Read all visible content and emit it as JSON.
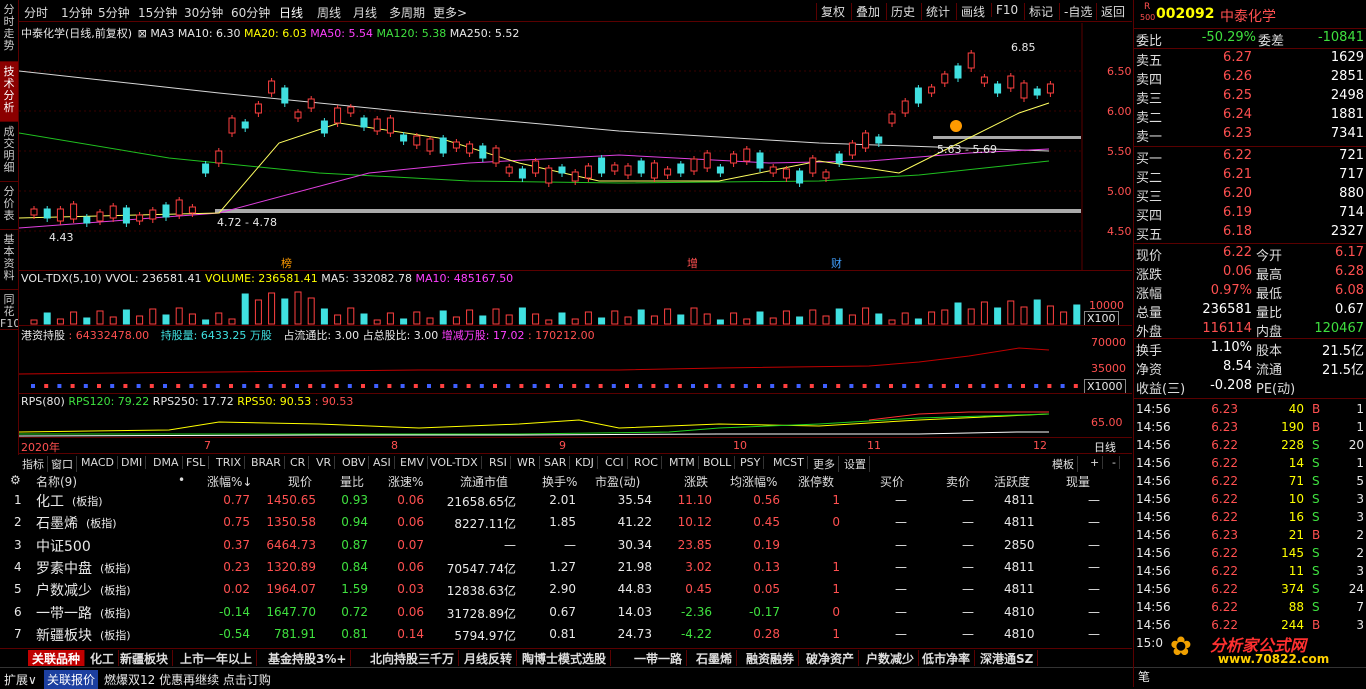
{
  "left_tabs": [
    "分时走势",
    "技术分析",
    "成交明细",
    "分价表",
    "基本资料",
    "同花F10"
  ],
  "periods": [
    "分时",
    "1分钟",
    "5分钟",
    "15分钟",
    "30分钟",
    "60分钟",
    "日线",
    "周线",
    "月线",
    "多周期",
    "更多>"
  ],
  "right_tools": [
    "复权",
    "叠加",
    "历史",
    "统计",
    "画线",
    "F10",
    "标记",
    "-自选",
    "返回"
  ],
  "main_legend": {
    "name": "中泰化学(日线,前复权)",
    "ma3": "MA3",
    "ma10": "MA10: 6.30",
    "ma20": "MA20: 6.03",
    "ma50": "MA50: 5.54",
    "ma120": "MA120: 5.38",
    "ma250": "MA250: 5.52"
  },
  "price_axis": [
    "6.50",
    "6.00",
    "5.50",
    "5.00",
    "4.50"
  ],
  "annotations": {
    "high": "6.85",
    "low": "4.43",
    "range1": "4.72 - 4.78",
    "range2": "5.63 - 5.69",
    "mark1": "榜",
    "mark2": "增",
    "mark3": "财"
  },
  "vol_legend": {
    "name": "VOL-TDX(5,10)",
    "vvol": "VVOL: 236581.41",
    "volume": "VOLUME: 236581.41",
    "ma5": "MA5: 332082.78",
    "ma10": "MA10: 485167.50"
  },
  "vol_axis": {
    "v1": "10000",
    "unit": "X100"
  },
  "hk_legend": {
    "name": "港资持股",
    "v0": ": 64332478.00",
    "v1": "持股量: 6433.25 万股",
    "v2": "占流通比: 3.00",
    "v3": "占总股比: 3.00",
    "v4": "增减万股: 17.02",
    "v5": ": 170212.00"
  },
  "hk_axis": {
    "a": "70000",
    "b": "35000",
    "unit": "X1000"
  },
  "rps_legend": {
    "name": "RPS(80)",
    "v1": "RPS120: 79.22",
    "v2": "RPS250: 17.72",
    "v3": "RPS50: 90.53",
    "v4": ": 90.53"
  },
  "rps_axis": "65.00",
  "time_axis": [
    "2020年",
    "7",
    "8",
    "9",
    "10",
    "11",
    "12"
  ],
  "time_mode": "日线",
  "indicators": [
    "指标",
    "窗口",
    "MACD",
    "DMI",
    "DMA",
    "FSL",
    "TRIX",
    "BRAR",
    "CR",
    "VR",
    "OBV",
    "ASI",
    "EMV",
    "VOL-TDX",
    "RSI",
    "WR",
    "SAR",
    "KDJ",
    "CCI",
    "ROC",
    "MTM",
    "BOLL",
    "PSY",
    "MCST",
    "更多",
    "设置"
  ],
  "template_btns": [
    "模板",
    "+",
    "-"
  ],
  "table_headers": [
    "名称(9)",
    "•",
    "涨幅%↓",
    "现价",
    "量比",
    "涨速%",
    "流通市值",
    "换手%",
    "市盈(动)",
    "涨跌",
    "均涨幅%",
    "涨停数",
    "买价",
    "卖价",
    "活跃度",
    "现量"
  ],
  "rows": [
    {
      "i": "1",
      "name": "化工",
      "tag": "(板指)",
      "chg": "0.77",
      "price": "1450.65",
      "lb": "0.93",
      "spd": "0.06",
      "mv": "21658.65亿",
      "hs": "2.01",
      "pe": "35.54",
      "zd": "11.10",
      "avg": "0.56",
      "zt": "1",
      "buy": "—",
      "sell": "—",
      "act": "4811",
      "vol": "—",
      "c": "r"
    },
    {
      "i": "2",
      "name": "石墨烯",
      "tag": "(板指)",
      "chg": "0.75",
      "price": "1350.58",
      "lb": "0.94",
      "spd": "0.06",
      "mv": "8227.11亿",
      "hs": "1.85",
      "pe": "41.22",
      "zd": "10.12",
      "avg": "0.45",
      "zt": "0",
      "buy": "—",
      "sell": "—",
      "act": "4811",
      "vol": "—",
      "c": "r"
    },
    {
      "i": "3",
      "name": "中证500",
      "tag": "",
      "chg": "0.37",
      "price": "6464.73",
      "lb": "0.87",
      "spd": "0.07",
      "mv": "—",
      "hs": "—",
      "pe": "30.34",
      "zd": "23.85",
      "avg": "0.19",
      "zt": "",
      "buy": "—",
      "sell": "—",
      "act": "2850",
      "vol": "—",
      "c": "r"
    },
    {
      "i": "4",
      "name": "罗素中盘",
      "tag": "(板指)",
      "chg": "0.23",
      "price": "1320.89",
      "lb": "0.84",
      "spd": "0.06",
      "mv": "70547.74亿",
      "hs": "1.27",
      "pe": "21.98",
      "zd": "3.02",
      "avg": "0.13",
      "zt": "1",
      "buy": "—",
      "sell": "—",
      "act": "4811",
      "vol": "—",
      "c": "r"
    },
    {
      "i": "5",
      "name": "户数减少",
      "tag": "(板指)",
      "chg": "0.02",
      "price": "1964.07",
      "lb": "1.59",
      "spd": "0.03",
      "mv": "12838.63亿",
      "hs": "2.90",
      "pe": "44.83",
      "zd": "0.45",
      "avg": "0.05",
      "zt": "1",
      "buy": "—",
      "sell": "—",
      "act": "4811",
      "vol": "—",
      "c": "r"
    },
    {
      "i": "6",
      "name": "一带一路",
      "tag": "(板指)",
      "chg": "-0.14",
      "price": "1647.70",
      "lb": "0.72",
      "spd": "0.06",
      "mv": "31728.89亿",
      "hs": "0.67",
      "pe": "14.03",
      "zd": "-2.36",
      "avg": "-0.17",
      "zt": "0",
      "buy": "—",
      "sell": "—",
      "act": "4810",
      "vol": "—",
      "c": "g"
    },
    {
      "i": "7",
      "name": "新疆板块",
      "tag": "(板指)",
      "chg": "-0.54",
      "price": "781.91",
      "lb": "0.81",
      "spd": "0.14",
      "mv": "5794.97亿",
      "hs": "0.81",
      "pe": "24.73",
      "zd": "-4.22",
      "avg": "0.28",
      "zt": "1",
      "buy": "—",
      "sell": "—",
      "act": "4810",
      "vol": "—",
      "c": "g"
    }
  ],
  "bottom_tabs": [
    "关联品种",
    "化工",
    "新疆板块",
    "上市一年以上",
    "基金持股3%+",
    "北向持股三千万",
    "月线反转",
    "陶博士模式选股",
    "一带一路",
    "石墨烯",
    "融资融券",
    "破净资产",
    "户数减少",
    "低市净率",
    "深港通SZ"
  ],
  "status": [
    "扩展∨",
    "关联报价",
    "燃爆双12 优惠再继续  点击订购"
  ],
  "stock": {
    "code": "002092",
    "name": "中泰化学",
    "r": "R",
    "n": "500"
  },
  "order": {
    "wb_l": "委比",
    "wb": "-50.29%",
    "wc_l": "委差",
    "wc": "-10841",
    "asks": [
      [
        "卖五",
        "6.27",
        "1629"
      ],
      [
        "卖四",
        "6.26",
        "2851"
      ],
      [
        "卖三",
        "6.25",
        "2498"
      ],
      [
        "卖二",
        "6.24",
        "1881"
      ],
      [
        "卖一",
        "6.23",
        "7341"
      ]
    ],
    "bids": [
      [
        "买一",
        "6.22",
        "721"
      ],
      [
        "买二",
        "6.21",
        "717"
      ],
      [
        "买三",
        "6.20",
        "880"
      ],
      [
        "买四",
        "6.19",
        "714"
      ],
      [
        "买五",
        "6.18",
        "2327"
      ]
    ]
  },
  "quote": [
    [
      "现价",
      "6.22",
      "今开",
      "6.17"
    ],
    [
      "涨跌",
      "0.06",
      "最高",
      "6.28"
    ],
    [
      "涨幅",
      "0.97%",
      "最低",
      "6.08"
    ],
    [
      "总量",
      "236581",
      "量比",
      "0.67"
    ],
    [
      "外盘",
      "116114",
      "内盘",
      "120467"
    ]
  ],
  "fin": [
    [
      "换手",
      "1.10%",
      "股本",
      "21.5亿"
    ],
    [
      "净资",
      "8.54",
      "流通",
      "21.5亿"
    ],
    [
      "收益(三)",
      "-0.208",
      "PE(动)",
      ""
    ]
  ],
  "ticks": [
    [
      "14:56",
      "6.23",
      "40",
      "B",
      "1"
    ],
    [
      "14:56",
      "6.23",
      "190",
      "B",
      "1"
    ],
    [
      "14:56",
      "6.22",
      "228",
      "S",
      "20"
    ],
    [
      "14:56",
      "6.22",
      "14",
      "S",
      "1"
    ],
    [
      "14:56",
      "6.22",
      "71",
      "S",
      "5"
    ],
    [
      "14:56",
      "6.22",
      "10",
      "S",
      "3"
    ],
    [
      "14:56",
      "6.22",
      "16",
      "S",
      "3"
    ],
    [
      "14:56",
      "6.23",
      "21",
      "B",
      "2"
    ],
    [
      "14:56",
      "6.22",
      "145",
      "S",
      "2"
    ],
    [
      "14:56",
      "6.22",
      "11",
      "S",
      "3"
    ],
    [
      "14:56",
      "6.22",
      "374",
      "S",
      "24"
    ],
    [
      "14:56",
      "6.22",
      "88",
      "S",
      "7"
    ],
    [
      "14:56",
      "6.22",
      "244",
      "B",
      "3"
    ]
  ],
  "tick_last": "15:0",
  "pen": "笔",
  "watermark": {
    "t1": "分析家公式网",
    "t2": "www.70822.com"
  },
  "colors": {
    "up": "#ff5050",
    "down": "#3fe0e0",
    "bg": "#000000",
    "frame": "#5a0000"
  }
}
